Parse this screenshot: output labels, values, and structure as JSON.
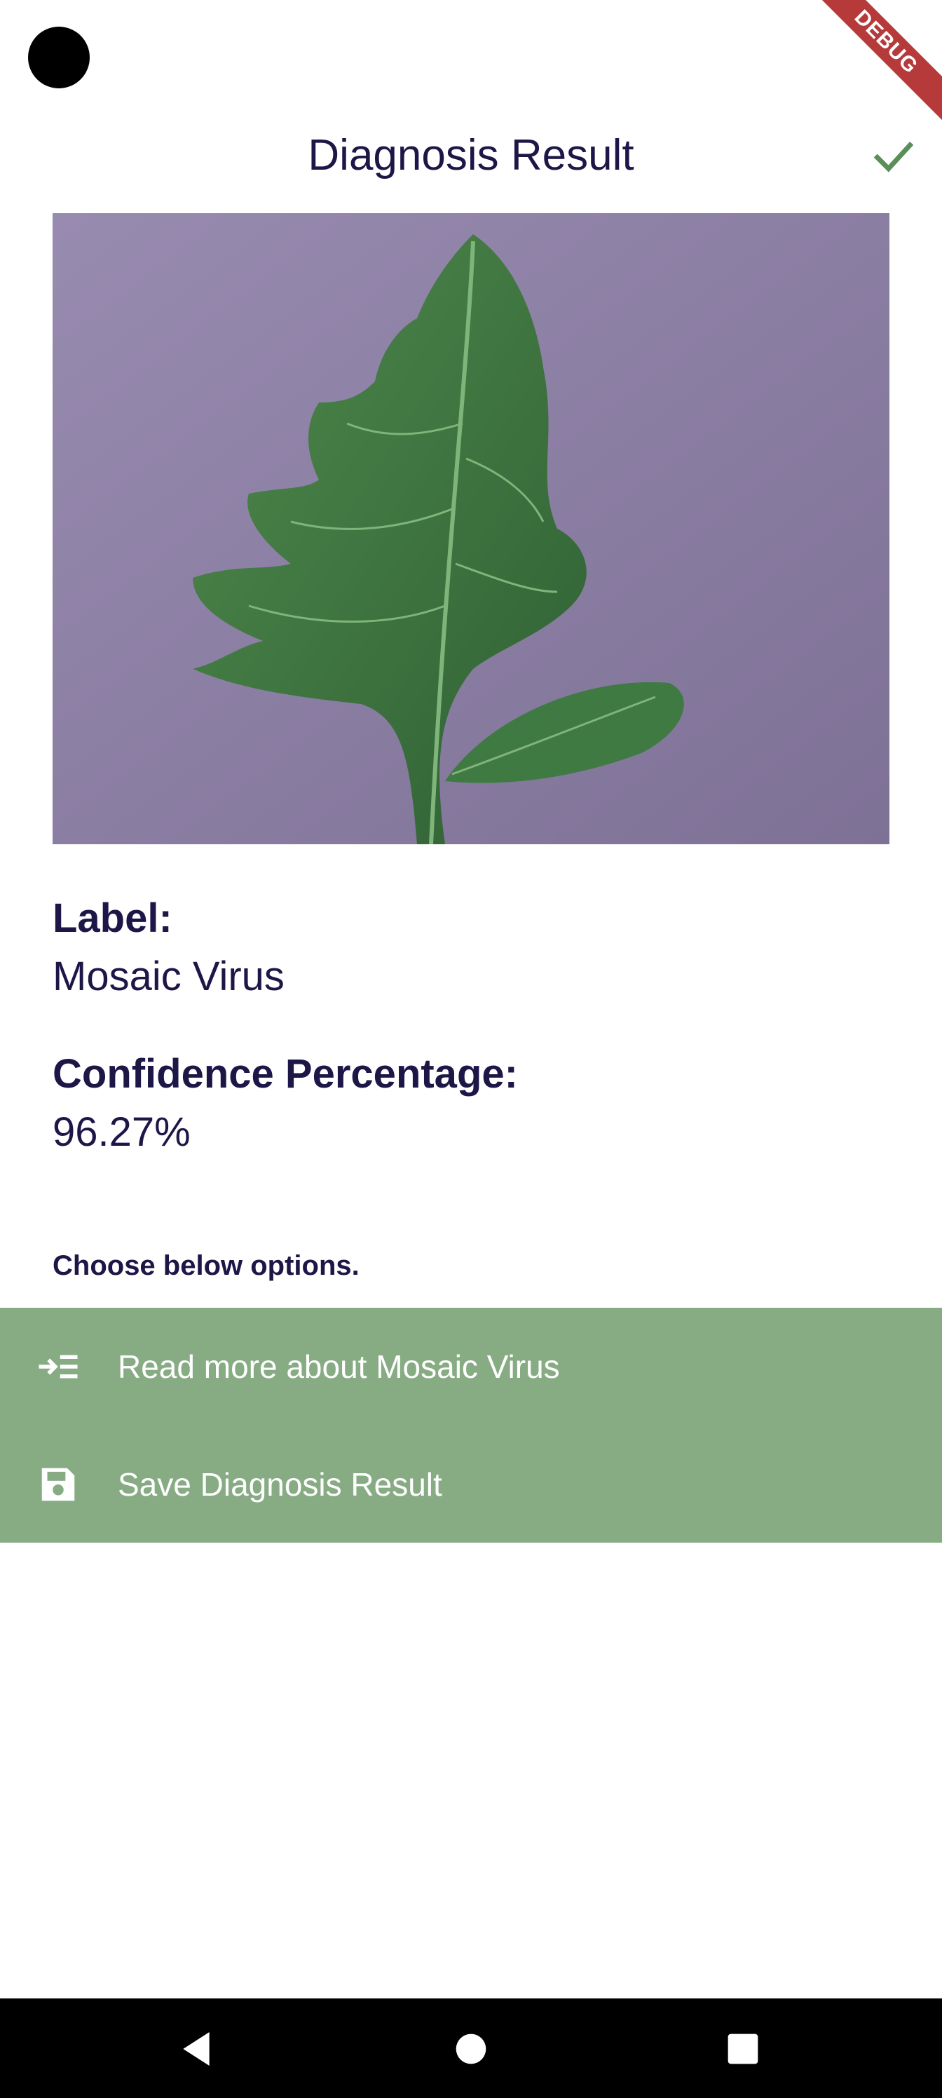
{
  "status_bar": {
    "debug_banner": "DEBUG"
  },
  "app_bar": {
    "title": "Diagnosis Result",
    "confirm_icon": "check-icon"
  },
  "image": {
    "subject": "tomato leaf photo"
  },
  "result": {
    "label_heading": "Label:",
    "label_value": "Mosaic Virus",
    "confidence_heading": "Confidence Percentage:",
    "confidence_value": "96.27%"
  },
  "options": {
    "intro": "Choose below options.",
    "items": [
      {
        "icon": "read-more-icon",
        "label": "Read more about Mosaic Virus"
      },
      {
        "icon": "save-icon",
        "label": "Save Diagnosis Result"
      }
    ]
  },
  "nav_bar": {
    "buttons": [
      "back",
      "home",
      "recent-apps"
    ]
  },
  "colors": {
    "title_text": "#1d1747",
    "accent_green": "#5b8f5a",
    "options_background": "#87ac84",
    "debug_banner": "#b73a3a",
    "nav_bar": "#000000"
  }
}
